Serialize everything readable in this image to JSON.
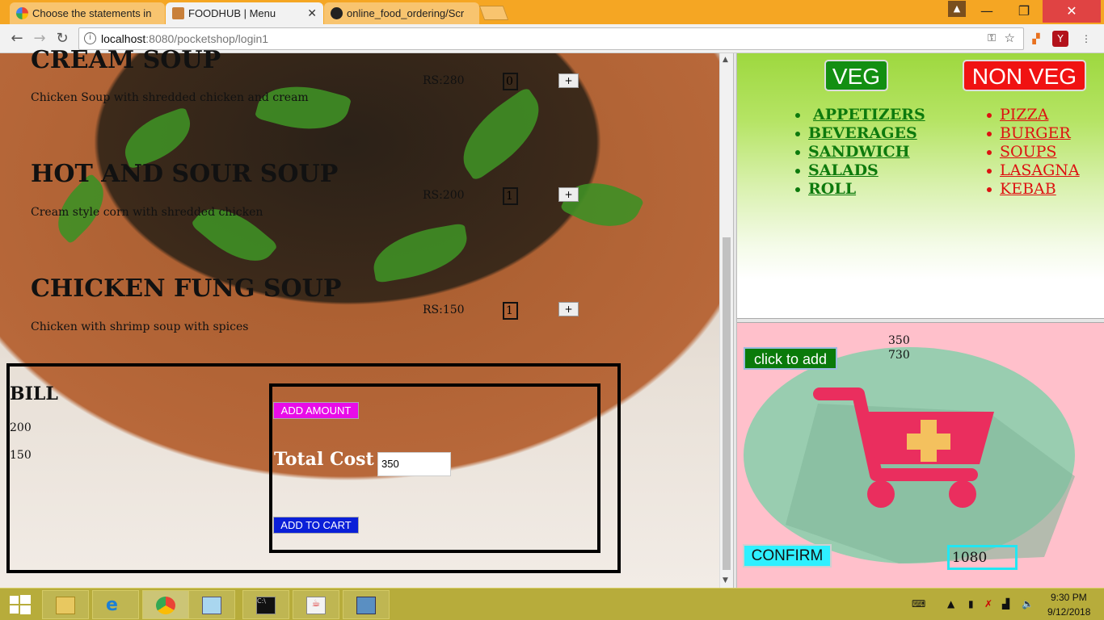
{
  "browser": {
    "tabs": [
      {
        "label": "Choose the statements in",
        "active": false
      },
      {
        "label": "FOODHUB | Menu",
        "active": true
      },
      {
        "label": "online_food_ordering/Scr",
        "active": false
      }
    ],
    "url_host": "localhost",
    "url_path": ":8080/pocketshop/login1"
  },
  "menu": {
    "items": [
      {
        "name": "CREAM SOUP",
        "desc": "Chicken Soup with shredded chicken and cream",
        "price": "RS:280",
        "qty": "0"
      },
      {
        "name": "HOT AND SOUR SOUP",
        "desc": "Cream style corn with shredded chicken",
        "price": "RS:200",
        "qty": "1"
      },
      {
        "name": "CHICKEN FUNG SOUP",
        "desc": "Chicken with shrimp soup with spices",
        "price": "RS:150",
        "qty": "1"
      }
    ],
    "plus_label": "+"
  },
  "bill": {
    "title": "BILL",
    "lines": [
      "200",
      "150"
    ],
    "add_amount_label": "ADD AMOUNT",
    "total_label": "Total Cost",
    "total_value": "350",
    "add_cart_label": "ADD TO CART"
  },
  "categories": {
    "veg_label": "VEG",
    "nonveg_label": "NON VEG",
    "veg": [
      "APPETIZERS",
      "BEVERAGES",
      "SANDWICH",
      "SALADS",
      "ROLL"
    ],
    "nonveg": [
      "PIZZA",
      "BURGER",
      "SOUPS",
      "LASAGNA",
      "KEBAB"
    ]
  },
  "cart": {
    "values": [
      "350",
      "730"
    ],
    "click_add_label": "click to add",
    "confirm_label": "CONFIRM",
    "grand_total": "1080"
  },
  "taskbar": {
    "time": "9:30 PM",
    "date": "9/12/2018"
  },
  "colors": {
    "tabbar": "#f5a623",
    "veg": "#138f12",
    "nonveg": "#f01212",
    "cart_bg": "#ffc0cb",
    "add_amount": "#e80ce8",
    "add_cart": "#0a1fd8",
    "confirm": "#2ff0ff"
  }
}
